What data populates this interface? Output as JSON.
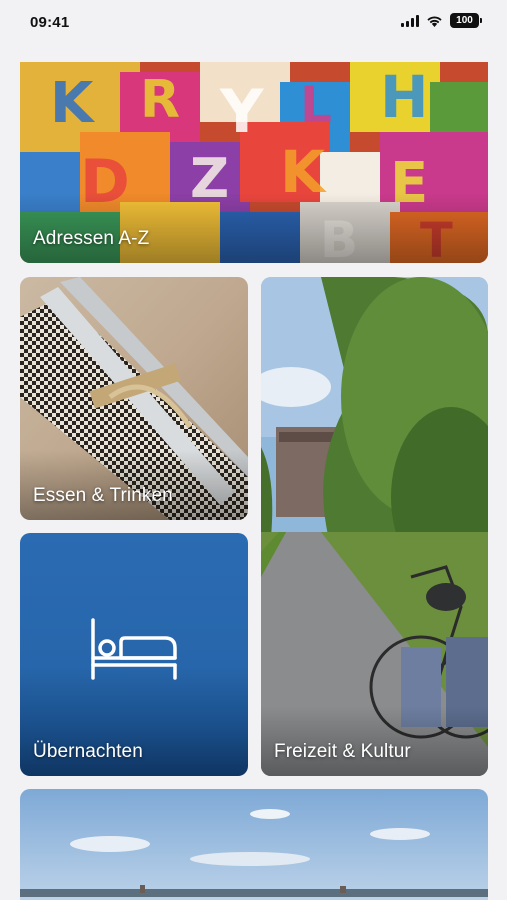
{
  "status_bar": {
    "time": "09:41",
    "battery": "100",
    "icons": [
      "signal-icon",
      "wifi-icon",
      "battery-icon"
    ]
  },
  "tiles": {
    "adressen": {
      "label": "Adressen A-Z",
      "image": "colorful-letters-photo"
    },
    "essen": {
      "label": "Essen & Trinken",
      "image": "cutlery-napkin-photo"
    },
    "uebernachten": {
      "label": "Übernachten",
      "icon": "bed-icon",
      "color": "#2a6ab0"
    },
    "freizeit": {
      "label": "Freizeit & Kultur",
      "image": "bicycle-bridge-photo"
    },
    "bottom": {
      "image": "river-landscape-photo"
    }
  }
}
